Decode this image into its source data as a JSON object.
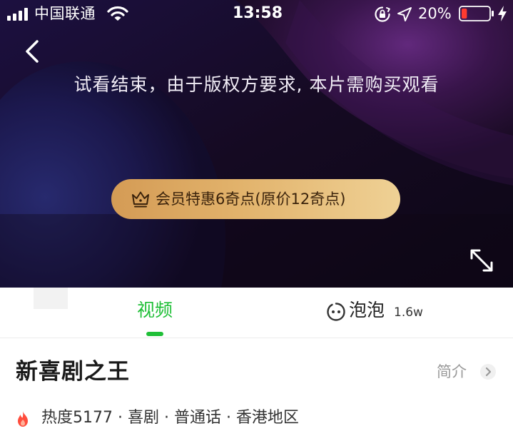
{
  "status_bar": {
    "carrier": "中国联通",
    "time": "13:58",
    "battery_percent": "20%",
    "battery_level": 0.2,
    "battery_color": "#ff3b30",
    "icons": [
      "signal-icon",
      "wifi-icon",
      "lock-rotation-icon",
      "location-icon",
      "battery-icon",
      "charging-icon"
    ]
  },
  "player": {
    "back_icon": "back-icon",
    "trial_message": "试看结束，由于版权方要求, 本片需购买观看",
    "vip_button": {
      "icon": "crown-icon",
      "label": "会员特惠6奇点(原价12奇点)"
    },
    "fullscreen_icon": "fullscreen-icon"
  },
  "tabs": {
    "video": {
      "label": "视频",
      "active": true,
      "color": "#1fbf37"
    },
    "bubble": {
      "icon": "bubble-icon",
      "label": "泡泡",
      "count": "1.6w"
    }
  },
  "info": {
    "title": "新喜剧之王",
    "intro_label": "简介",
    "meta": {
      "icon": "fire-icon",
      "text": "热度5177 · 喜剧 · 普通话 · 香港地区"
    }
  }
}
